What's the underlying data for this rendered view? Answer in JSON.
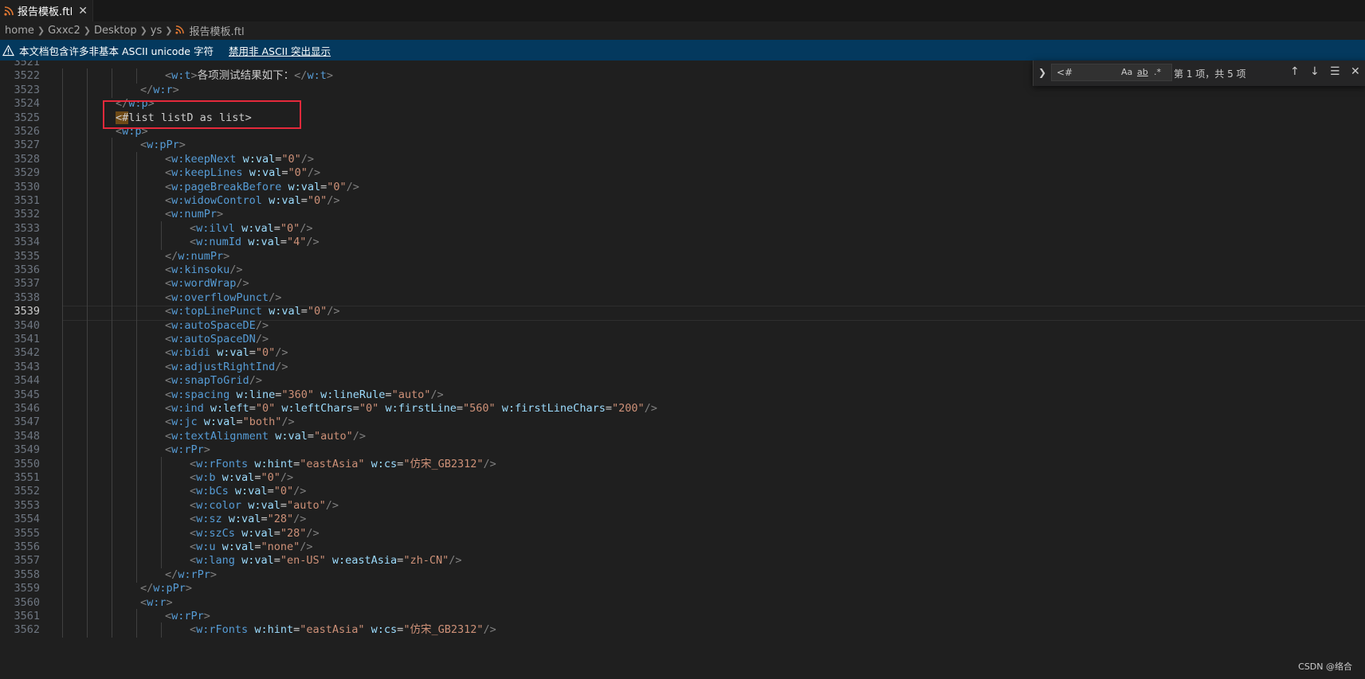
{
  "tab": {
    "label": "报告模板.ftl",
    "close": "✕",
    "file_icon": "rss-file-icon"
  },
  "breadcrumb": [
    "home",
    "Gxxc2",
    "Desktop",
    "ys",
    "报告模板.ftl"
  ],
  "notice": {
    "text": "本文档包含许多非基本 ASCII unicode 字符",
    "action": "禁用非 ASCII 突出显示"
  },
  "find": {
    "value": "<#",
    "count": "第 1 项，共 5 项",
    "options": [
      "Aa",
      "ab",
      ".*"
    ]
  },
  "editor": {
    "active_line": 3539,
    "lines": [
      {
        "n": 3521,
        "text": ""
      },
      {
        "n": 3522,
        "text": "<w:t>各项测试结果如下：</w:t>"
      },
      {
        "n": 3523,
        "text": "</w:r>"
      },
      {
        "n": 3524,
        "text": "</w:p>"
      },
      {
        "n": 3525,
        "text": "<#list listD as list>"
      },
      {
        "n": 3526,
        "text": "<w:p>"
      },
      {
        "n": 3527,
        "text": "<w:pPr>"
      },
      {
        "n": 3528,
        "text": "<w:keepNext w:val=\"0\"/>"
      },
      {
        "n": 3529,
        "text": "<w:keepLines w:val=\"0\"/>"
      },
      {
        "n": 3530,
        "text": "<w:pageBreakBefore w:val=\"0\"/>"
      },
      {
        "n": 3531,
        "text": "<w:widowControl w:val=\"0\"/>"
      },
      {
        "n": 3532,
        "text": "<w:numPr>"
      },
      {
        "n": 3533,
        "text": "<w:ilvl w:val=\"0\"/>"
      },
      {
        "n": 3534,
        "text": "<w:numId w:val=\"4\"/>"
      },
      {
        "n": 3535,
        "text": "</w:numPr>"
      },
      {
        "n": 3536,
        "text": "<w:kinsoku/>"
      },
      {
        "n": 3537,
        "text": "<w:wordWrap/>"
      },
      {
        "n": 3538,
        "text": "<w:overflowPunct/>"
      },
      {
        "n": 3539,
        "text": "<w:topLinePunct w:val=\"0\"/>"
      },
      {
        "n": 3540,
        "text": "<w:autoSpaceDE/>"
      },
      {
        "n": 3541,
        "text": "<w:autoSpaceDN/>"
      },
      {
        "n": 3542,
        "text": "<w:bidi w:val=\"0\"/>"
      },
      {
        "n": 3543,
        "text": "<w:adjustRightInd/>"
      },
      {
        "n": 3544,
        "text": "<w:snapToGrid/>"
      },
      {
        "n": 3545,
        "text": "<w:spacing w:line=\"360\" w:lineRule=\"auto\"/>"
      },
      {
        "n": 3546,
        "text": "<w:ind w:left=\"0\" w:leftChars=\"0\" w:firstLine=\"560\" w:firstLineChars=\"200\"/>"
      },
      {
        "n": 3547,
        "text": "<w:jc w:val=\"both\"/>"
      },
      {
        "n": 3548,
        "text": "<w:textAlignment w:val=\"auto\"/>"
      },
      {
        "n": 3549,
        "text": "<w:rPr>"
      },
      {
        "n": 3550,
        "text": "<w:rFonts w:hint=\"eastAsia\" w:cs=\"仿宋_GB2312\"/>"
      },
      {
        "n": 3551,
        "text": "<w:b w:val=\"0\"/>"
      },
      {
        "n": 3552,
        "text": "<w:bCs w:val=\"0\"/>"
      },
      {
        "n": 3553,
        "text": "<w:color w:val=\"auto\"/>"
      },
      {
        "n": 3554,
        "text": "<w:sz w:val=\"28\"/>"
      },
      {
        "n": 3555,
        "text": "<w:szCs w:val=\"28\"/>"
      },
      {
        "n": 3556,
        "text": "<w:u w:val=\"none\"/>"
      },
      {
        "n": 3557,
        "text": "<w:lang w:val=\"en-US\" w:eastAsia=\"zh-CN\"/>"
      },
      {
        "n": 3558,
        "text": "</w:rPr>"
      },
      {
        "n": 3559,
        "text": "</w:pPr>"
      },
      {
        "n": 3560,
        "text": "<w:r>"
      },
      {
        "n": 3561,
        "text": "<w:rPr>"
      },
      {
        "n": 3562,
        "text": "<w:rFonts w:hint=\"eastAsia\" w:cs=\"仿宋_GB2312\"/>"
      }
    ]
  },
  "watermark": "CSDN @络合",
  "colors": {
    "tag": "#569cd6",
    "attr": "#9cdcfe",
    "string": "#ce9178",
    "text": "#cccccc",
    "notice_bg": "#04395e",
    "find_match": "#6e4a16",
    "annotation": "#e5293b"
  }
}
